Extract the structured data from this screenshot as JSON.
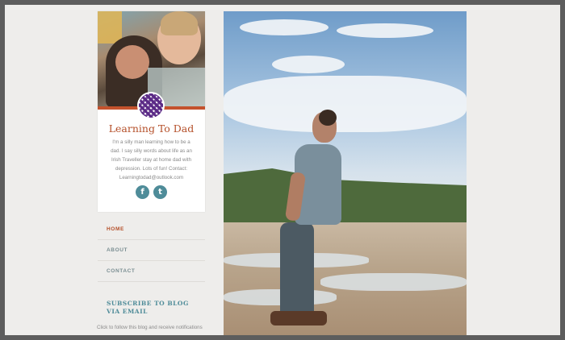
{
  "site": {
    "title": "Learning To Dad",
    "description": "I'm a silly man learning how to be a dad. I say silly words about life as an Irish Traveller stay at home dad with depression. Lots of fun! Contact: Learningtodad@outlook.com"
  },
  "social": {
    "facebook_glyph": "f",
    "twitter_glyph": "t"
  },
  "nav": {
    "items": [
      {
        "label": "HOME"
      },
      {
        "label": "ABOUT"
      },
      {
        "label": "CONTACT"
      }
    ]
  },
  "subscribe": {
    "title": "SUBSCRIBE TO BLOG VIA EMAIL",
    "text": "Click to follow this blog and receive notifications"
  },
  "colors": {
    "accent": "#c4522d",
    "teal": "#4f8c99",
    "background": "#eeedeb"
  }
}
